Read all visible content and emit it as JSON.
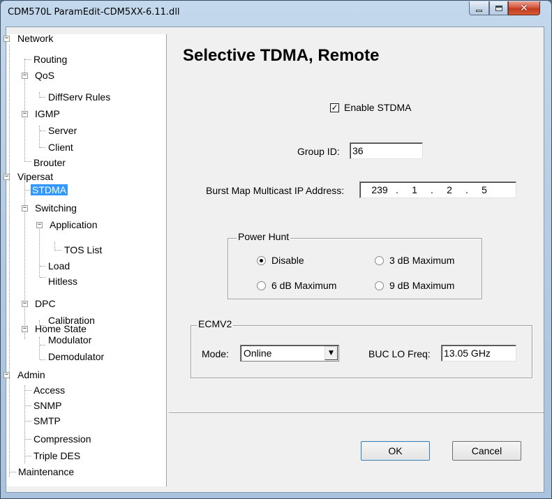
{
  "window": {
    "title": "CDM570L ParamEdit-CDM5XX-6.11.dll",
    "minimize_glyph": "",
    "maximize_glyph": "",
    "close_glyph": "✕"
  },
  "tree": {
    "items": [
      {
        "label": "Network",
        "expander": "−"
      },
      {
        "label": "Routing"
      },
      {
        "label": "QoS",
        "expander": "−"
      },
      {
        "label": "DiffServ Rules"
      },
      {
        "label": "IGMP",
        "expander": "−"
      },
      {
        "label": "Server"
      },
      {
        "label": "Client"
      },
      {
        "label": "Brouter"
      },
      {
        "label": "Vipersat",
        "expander": "−"
      },
      {
        "label": "STDMA",
        "selected": true
      },
      {
        "label": "Switching",
        "expander": "−"
      },
      {
        "label": "Application",
        "expander": "−"
      },
      {
        "label": "TOS List"
      },
      {
        "label": "Load"
      },
      {
        "label": "Hitless"
      },
      {
        "label": "DPC",
        "expander": "−"
      },
      {
        "label": "Calibration"
      },
      {
        "label": "Home State",
        "expander": "−"
      },
      {
        "label": "Modulator"
      },
      {
        "label": "Demodulator"
      },
      {
        "label": "Admin",
        "expander": "−"
      },
      {
        "label": "Access"
      },
      {
        "label": "SNMP"
      },
      {
        "label": "SMTP"
      },
      {
        "label": "Compression"
      },
      {
        "label": "Triple DES"
      },
      {
        "label": "Maintenance"
      }
    ]
  },
  "page": {
    "title": "Selective TDMA, Remote",
    "enable_stdma": {
      "label": "Enable STDMA",
      "checked": true,
      "check_glyph": "✓"
    },
    "group_id": {
      "label": "Group ID:",
      "value": "36"
    },
    "burst_map": {
      "label": "Burst Map Multicast IP Address:",
      "octets": [
        "239",
        "1",
        "2",
        "5"
      ],
      "separator": "."
    },
    "power_hunt": {
      "title": "Power Hunt",
      "options": [
        {
          "label": "Disable",
          "selected": true
        },
        {
          "label": "3 dB Maximum",
          "selected": false
        },
        {
          "label": "6 dB Maximum",
          "selected": false
        },
        {
          "label": "9 dB Maximum",
          "selected": false
        }
      ]
    },
    "ecmv2": {
      "title": "ECMV2",
      "mode_label": "Mode:",
      "mode_value": "Online",
      "dropdown_glyph": "▼",
      "buc_label": "BUC LO Freq:",
      "buc_value": "13.05 GHz"
    }
  },
  "buttons": {
    "ok": "OK",
    "cancel": "Cancel"
  },
  "colors": {
    "selection": "#3399ff",
    "close_button": "#c23c1f",
    "background": "#f0f0f0"
  }
}
